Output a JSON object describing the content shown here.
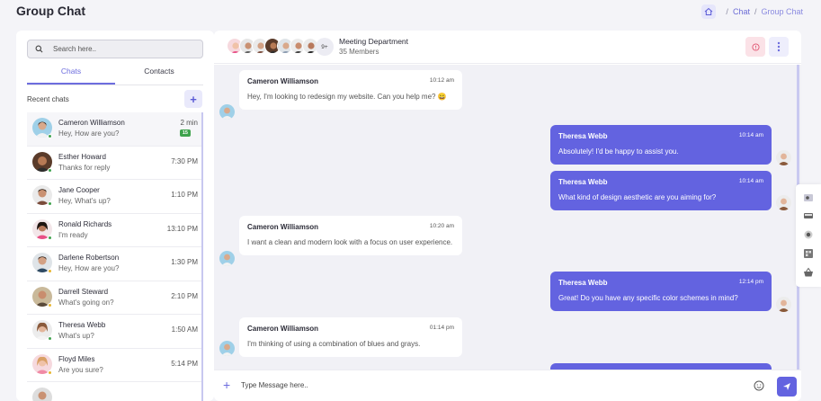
{
  "page": {
    "title": "Group Chat"
  },
  "breadcrumb": {
    "home_icon": "home-icon",
    "items": [
      "Chat",
      "Group Chat"
    ],
    "separator": "/"
  },
  "sidebar": {
    "search_placeholder": "Search here..",
    "tabs": [
      "Chats",
      "Contacts"
    ],
    "active_tab": "Chats",
    "recent_label": "Recent chats",
    "add_label": "+",
    "chats": [
      {
        "name": "Cameron Williamson",
        "message": "Hey, How are you?",
        "time": "2 min",
        "badge": "15",
        "status": "#3fa34d",
        "active": true
      },
      {
        "name": "Esther Howard",
        "message": "Thanks for reply",
        "time": "7:30 PM",
        "status": "#3fa34d"
      },
      {
        "name": "Jane Cooper",
        "message": "Hey, What's up?",
        "time": "1:10 PM",
        "status": "#3fa34d"
      },
      {
        "name": "Ronald Richards",
        "message": "I'm ready",
        "time": "13:10 PM",
        "status": "#3fa34d"
      },
      {
        "name": "Darlene Robertson",
        "message": "Hey, How are you?",
        "time": "1:30 PM",
        "status": "#e8b630"
      },
      {
        "name": "Darrell Steward",
        "message": "What's going on?",
        "time": "2:10 PM",
        "status": "#e8b630"
      },
      {
        "name": "Theresa Webb",
        "message": "What's up?",
        "time": "1:50 AM",
        "status": "#3fa34d"
      },
      {
        "name": "Floyd Miles",
        "message": "Are you sure?",
        "time": "5:14 PM",
        "status": "#e8b630"
      }
    ]
  },
  "conversation": {
    "group_name": "Meeting Department",
    "members": "35 Members",
    "more_count": "9+",
    "messages": [
      {
        "from": "Cameron Williamson",
        "time": "10:12 am",
        "text": "Hey, I'm looking to redesign my website. Can you help me? 😀",
        "side": "in"
      },
      {
        "from": "Theresa Webb",
        "time": "10:14 am",
        "text": "Absolutely! I'd be happy to assist you.",
        "side": "out"
      },
      {
        "from": "Theresa Webb",
        "time": "10:14 am",
        "text": "What kind of design aesthetic are you aiming for?",
        "side": "out"
      },
      {
        "from": "Cameron Williamson",
        "time": "10:20 am",
        "text": "I want a clean and modern look with a focus on user experience.",
        "side": "in"
      },
      {
        "from": "Theresa Webb",
        "time": "12:14 pm",
        "text": "Great! Do you have any specific color schemes in mind?",
        "side": "out"
      },
      {
        "from": "Cameron Williamson",
        "time": "01:14 pm",
        "text": "I'm thinking of using a combination of blues and grays.",
        "side": "in"
      }
    ],
    "composer_placeholder": "Type Message here.."
  },
  "colors": {
    "accent": "#6363e0",
    "online": "#3fa34d",
    "away": "#e8b630"
  }
}
